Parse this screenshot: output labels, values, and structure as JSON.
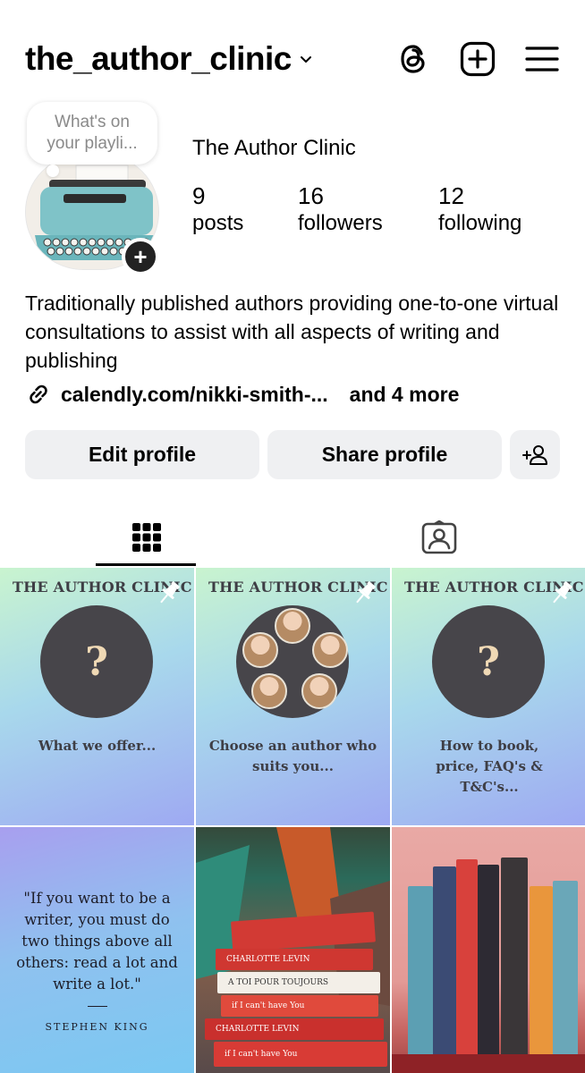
{
  "header": {
    "username": "the_author_clinic"
  },
  "profile": {
    "note": "What's on your playli...",
    "display_name": "The Author Clinic",
    "stats": [
      {
        "value": "9",
        "label": "posts"
      },
      {
        "value": "16",
        "label": "followers"
      },
      {
        "value": "12",
        "label": "following"
      }
    ],
    "bio": "Traditionally published authors providing one-to-one virtual consultations to assist with all aspects of writing and publishing",
    "link": "calendly.com/nikki-smith-...",
    "link_more": "and 4 more"
  },
  "buttons": {
    "edit": "Edit profile",
    "share": "Share profile"
  },
  "posts": [
    {
      "title": "THE AUTHOR CLINIC",
      "symbol": "?",
      "caption": "What we offer..."
    },
    {
      "title": "THE AUTHOR CLINIC",
      "caption": "Choose an author who suits you..."
    },
    {
      "title": "THE AUTHOR CLINIC",
      "symbol": "?",
      "caption": "How to book, price, FAQ's & T&C's..."
    },
    {
      "quote": "\"If you want to be a writer, you must do two things above all others: read a lot and write a lot.\"",
      "author": "STEPHEN KING"
    }
  ],
  "book_labels": [
    "CHARLOTTE LEVIN",
    "A TOI POUR TOUJOURS",
    "if I can't have You",
    "CHARLOTTE LEVIN",
    "if I can't have You"
  ],
  "colors": {
    "button_bg": "#eff0f2",
    "accent_dark": "#47454a"
  }
}
